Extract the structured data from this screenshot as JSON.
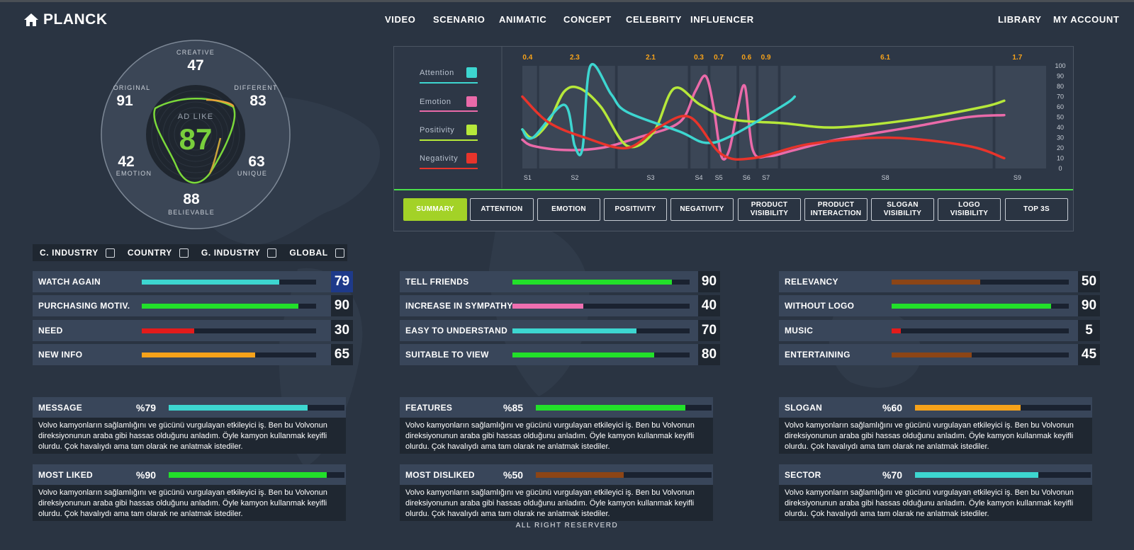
{
  "header": {
    "brand": "PLANCK",
    "nav": [
      "VIDEO",
      "SCENARIO",
      "ANIMATIC",
      "CONCEPT",
      "CELEBRITY",
      "INFLUENCER"
    ],
    "right": [
      "LIBRARY",
      "MY ACCOUNT"
    ]
  },
  "radar": {
    "center_label": "AD LIKE",
    "center_value": "87",
    "axes": [
      {
        "label": "CREATIVE",
        "value": "47"
      },
      {
        "label": "DIFFERENT",
        "value": "83"
      },
      {
        "label": "UNIQUE",
        "value": "63"
      },
      {
        "label": "BELIEVABLE",
        "value": "88"
      },
      {
        "label": "EMOTION",
        "value": "42"
      },
      {
        "label": "ORIGINAL",
        "value": "91"
      }
    ]
  },
  "chart_data": {
    "type": "line",
    "scene_labels": [
      "S1",
      "S2",
      "S3",
      "S4",
      "S5",
      "S6",
      "S7",
      "S8",
      "S9"
    ],
    "scene_values": [
      "0.4",
      "2.3",
      "2.1",
      "0.3",
      "0.7",
      "0.6",
      "0.9",
      "6.1",
      "1.7"
    ],
    "y_ticks": [
      "100",
      "90",
      "80",
      "70",
      "60",
      "50",
      "40",
      "30",
      "20",
      "10",
      "0"
    ],
    "ylim": [
      0,
      100
    ],
    "series": [
      {
        "name": "Attention",
        "color": "#3dd6d0",
        "values": [
          [
            0,
            38
          ],
          [
            2,
            30
          ],
          [
            8,
            62
          ],
          [
            10,
            22
          ],
          [
            11.5,
            20
          ],
          [
            13,
            100
          ],
          [
            17,
            72
          ],
          [
            20,
            55
          ],
          [
            30,
            36
          ],
          [
            35,
            25
          ],
          [
            40,
            32
          ],
          [
            50,
            62
          ],
          [
            52,
            70
          ]
        ]
      },
      {
        "name": "Emotion",
        "color": "#ea6aa9",
        "values": [
          [
            0,
            28
          ],
          [
            2,
            22
          ],
          [
            8,
            18
          ],
          [
            15,
            20
          ],
          [
            22,
            30
          ],
          [
            30,
            45
          ],
          [
            33,
            75
          ],
          [
            35,
            90
          ],
          [
            36.5,
            60
          ],
          [
            38,
            12
          ],
          [
            39.5,
            18
          ],
          [
            41,
            55
          ],
          [
            42.5,
            80
          ],
          [
            44,
            18
          ],
          [
            47,
            12
          ],
          [
            52,
            18
          ],
          [
            60,
            28
          ],
          [
            74,
            40
          ],
          [
            85,
            50
          ],
          [
            92,
            52
          ]
        ]
      },
      {
        "name": "Positivity",
        "color": "#b6e83a",
        "values": [
          [
            0,
            38
          ],
          [
            2,
            30
          ],
          [
            5,
            45
          ],
          [
            8,
            75
          ],
          [
            11,
            78
          ],
          [
            15,
            60
          ],
          [
            20,
            22
          ],
          [
            25,
            35
          ],
          [
            29,
            78
          ],
          [
            34,
            62
          ],
          [
            40,
            48
          ],
          [
            50,
            44
          ],
          [
            60,
            40
          ],
          [
            75,
            48
          ],
          [
            88,
            60
          ],
          [
            92,
            66
          ]
        ]
      },
      {
        "name": "Negativity",
        "color": "#e8342b",
        "values": [
          [
            0,
            70
          ],
          [
            5,
            45
          ],
          [
            12,
            30
          ],
          [
            20,
            20
          ],
          [
            26,
            40
          ],
          [
            32,
            50
          ],
          [
            38,
            14
          ],
          [
            44,
            10
          ],
          [
            55,
            24
          ],
          [
            70,
            30
          ],
          [
            85,
            22
          ],
          [
            92,
            10
          ]
        ]
      }
    ]
  },
  "tabs": [
    "SUMMARY",
    "ATTENTION",
    "EMOTION",
    "POSITIVITY",
    "NEGATIVITY",
    "PRODUCT VISIBILITY",
    "PRODUCT INTERACTION",
    "SLOGAN VISIBILITY",
    "LOGO VISIBILITY",
    "TOP 3S"
  ],
  "active_tab": "SUMMARY",
  "filters": [
    "C. INDUSTRY",
    "COUNTRY",
    "G. INDUSTRY",
    "GLOBAL"
  ],
  "metrics": [
    [
      {
        "label": "WATCH AGAIN",
        "value": "79",
        "pct": 0.79,
        "color": "#3dd6d0",
        "selected": true
      },
      {
        "label": "PURCHASING MOTIV.",
        "value": "90",
        "pct": 0.9,
        "color": "#22e02a"
      },
      {
        "label": "NEED",
        "value": "30",
        "pct": 0.3,
        "color": "#e31b1b"
      },
      {
        "label": "NEW INFO",
        "value": "65",
        "pct": 0.65,
        "color": "#f6a21a"
      }
    ],
    [
      {
        "label": "TELL FRIENDS",
        "value": "90",
        "pct": 0.9,
        "color": "#22e02a"
      },
      {
        "label": "INCREASE IN SYMPATHY",
        "value": "40",
        "pct": 0.4,
        "color": "#ef6fb0"
      },
      {
        "label": "EASY TO UNDERSTAND",
        "value": "70",
        "pct": 0.7,
        "color": "#3dd6d0"
      },
      {
        "label": "SUITABLE TO VIEW",
        "value": "80",
        "pct": 0.8,
        "color": "#22e02a"
      }
    ],
    [
      {
        "label": "RELEVANCY",
        "value": "50",
        "pct": 0.5,
        "color": "#8c4516"
      },
      {
        "label": "WITHOUT LOGO",
        "value": "90",
        "pct": 0.9,
        "color": "#22e02a"
      },
      {
        "label": "MUSIC",
        "value": "5",
        "pct": 0.05,
        "color": "#e31b1b"
      },
      {
        "label": "ENTERTAINING",
        "value": "45",
        "pct": 0.45,
        "color": "#8c4516"
      }
    ]
  ],
  "cards": [
    [
      {
        "title": "MESSAGE",
        "pct_label": "%79",
        "pct": 0.79,
        "color": "#3dd6d0",
        "text": "Volvo kamyonların sağlamlığını ve gücünü vurgulayan etkileyici iş. Ben bu Volvonun direksiyonunun araba gibi hassas olduğunu anladım. Öyle kamyon kullanmak keyifli olurdu. Çok havalıydı ama tam olarak ne anlatmak istediler."
      },
      {
        "title": "MOST LIKED",
        "pct_label": "%90",
        "pct": 0.9,
        "color": "#22e02a",
        "text": "Volvo kamyonların sağlamlığını ve gücünü vurgulayan etkileyici iş. Ben bu Volvonun direksiyonunun araba gibi hassas olduğunu anladım. Öyle kamyon kullanmak keyifli olurdu. Çok havalıydı ama tam olarak ne anlatmak istediler."
      }
    ],
    [
      {
        "title": "FEATURES",
        "pct_label": "%85",
        "pct": 0.85,
        "color": "#22e02a",
        "text": "Volvo kamyonların sağlamlığını ve gücünü vurgulayan etkileyici iş. Ben bu Volvonun direksiyonunun araba gibi hassas olduğunu anladım. Öyle kamyon kullanmak keyifli olurdu. Çok havalıydı ama tam olarak ne anlatmak istediler."
      },
      {
        "title": "MOST DISLIKED",
        "pct_label": "%50",
        "pct": 0.5,
        "color": "#8c4516",
        "text": "Volvo kamyonların sağlamlığını ve gücünü vurgulayan etkileyici iş. Ben bu Volvonun direksiyonunun araba gibi hassas olduğunu anladım. Öyle kamyon kullanmak keyifli olurdu. Çok havalıydı ama tam olarak ne anlatmak istediler."
      }
    ],
    [
      {
        "title": "SLOGAN",
        "pct_label": "%60",
        "pct": 0.6,
        "color": "#f6a21a",
        "text": "Volvo kamyonların sağlamlığını ve gücünü vurgulayan etkileyici iş. Ben bu Volvonun direksiyonunun araba gibi hassas olduğunu anladım. Öyle kamyon kullanmak keyifli olurdu. Çok havalıydı ama tam olarak ne anlatmak istediler."
      },
      {
        "title": "SECTOR",
        "pct_label": "%70",
        "pct": 0.7,
        "color": "#3dd6d0",
        "text": "Volvo kamyonların sağlamlığını ve gücünü vurgulayan etkileyici iş. Ben bu Volvonun direksiyonunun araba gibi hassas olduğunu anladım. Öyle kamyon kullanmak keyifli olurdu. Çok havalıydı ama tam olarak ne anlatmak istediler."
      }
    ]
  ],
  "footer": "ALL RIGHT RESERVERD"
}
